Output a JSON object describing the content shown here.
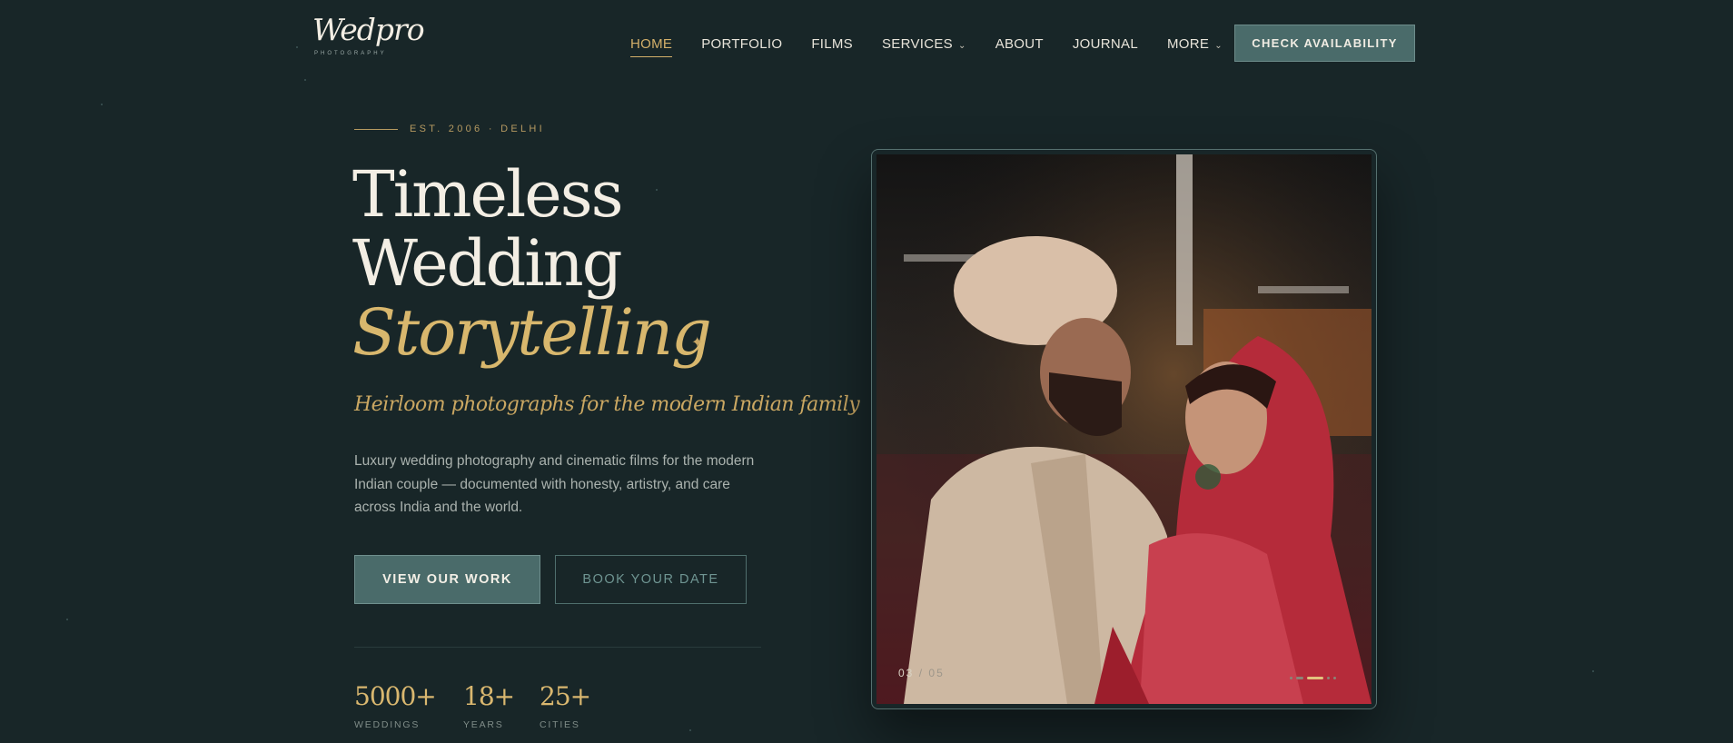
{
  "brand": {
    "name": "Wedpro",
    "subtitle": "PHOTOGRAPHY"
  },
  "nav": {
    "items": [
      {
        "label": "HOME",
        "active": true,
        "dropdown": false
      },
      {
        "label": "PORTFOLIO",
        "active": false,
        "dropdown": false
      },
      {
        "label": "FILMS",
        "active": false,
        "dropdown": false
      },
      {
        "label": "SERVICES",
        "active": false,
        "dropdown": true
      },
      {
        "label": "ABOUT",
        "active": false,
        "dropdown": false
      },
      {
        "label": "JOURNAL",
        "active": false,
        "dropdown": false
      },
      {
        "label": "MORE",
        "active": false,
        "dropdown": true
      }
    ],
    "cta": "CHECK AVAILABILITY"
  },
  "hero": {
    "eyebrow": "EST. 2006 · DELHI",
    "headline": {
      "line1": "Timeless",
      "line2": "Wedding",
      "line3": "Storytelling"
    },
    "tagline": "Heirloom photographs for the modern Indian family",
    "description": "Luxury wedding photography and cinematic films for the modern Indian couple — documented with honesty, artistry, and care across India and the world.",
    "primary_button": "VIEW OUR WORK",
    "secondary_button": "BOOK YOUR DATE",
    "stats": [
      {
        "value": "5000+",
        "label": "WEDDINGS"
      },
      {
        "value": "18+",
        "label": "YEARS"
      },
      {
        "value": "25+",
        "label": "CITIES"
      }
    ]
  },
  "slider": {
    "current": "03",
    "separator": "/",
    "total": "05",
    "slide_index": 3,
    "slide_count": 5
  },
  "colors": {
    "background": "#182628",
    "accent_gold": "#d4b06a",
    "button_teal": "#4a6b6a",
    "text_light": "#f3eee4"
  },
  "icons": {
    "dropdown": "chevron-down-icon",
    "sparkle": "sparkle-icon"
  }
}
